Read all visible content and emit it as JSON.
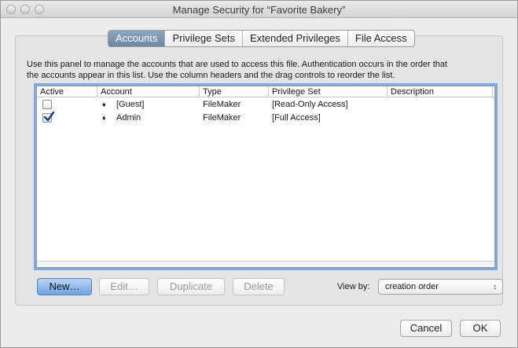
{
  "window": {
    "title": "Manage Security for “Favorite Bakery”"
  },
  "tabs": [
    {
      "label": "Accounts",
      "active": true
    },
    {
      "label": "Privilege Sets",
      "active": false
    },
    {
      "label": "Extended Privileges",
      "active": false
    },
    {
      "label": "File Access",
      "active": false
    }
  ],
  "description": {
    "line1": "Use this panel to manage the accounts that are used to access this file.  Authentication occurs in the order that",
    "line2": "the accounts appear in this list.  Use the column headers and the drag controls to reorder the list."
  },
  "table": {
    "columns": [
      "Active",
      "Account",
      "Type",
      "Privilege Set",
      "Description"
    ],
    "rows": [
      {
        "active": false,
        "drag_icon": "♦",
        "account": "[Guest]",
        "type": "FileMaker",
        "privilege_set": "[Read-Only Access]",
        "description": ""
      },
      {
        "active": true,
        "drag_icon": "♦",
        "account": "Admin",
        "type": "FileMaker",
        "privilege_set": "[Full Access]",
        "description": ""
      }
    ]
  },
  "buttons": {
    "new": "New…",
    "edit": "Edit…",
    "duplicate": "Duplicate",
    "delete": "Delete",
    "cancel": "Cancel",
    "ok": "OK"
  },
  "view_by": {
    "label": "View by:",
    "value": "creation order",
    "arrow": "↕"
  },
  "colors": {
    "accent": "#6e86a6",
    "focus_ring": "#7fa9e0",
    "default_button": "#6ea3e3"
  }
}
